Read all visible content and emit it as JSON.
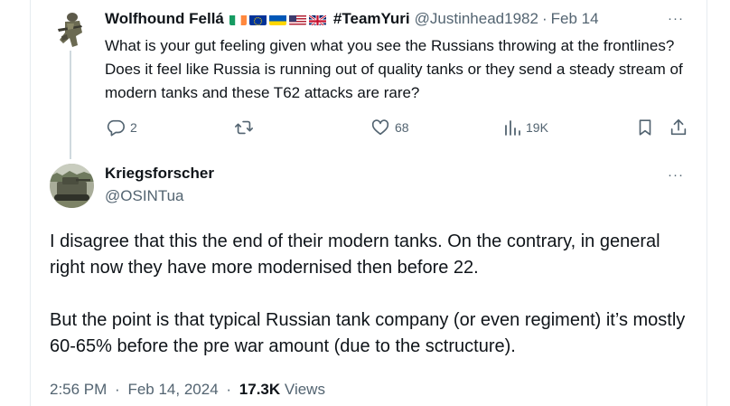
{
  "reply_tweet": {
    "author": {
      "display_name": "Wolfhound Fellá",
      "flags": [
        "ireland-flag",
        "eu-flag",
        "ukraine-flag",
        "usa-flag",
        "uk-flag"
      ],
      "hashtag": "#TeamYuri",
      "handle": "@Justinhead1982",
      "date": "Feb 14"
    },
    "text": "What is your gut feeling given what you see the Russians throwing at the frontlines? Does it feel like Russia is running out of quality tanks or they send a steady stream of modern tanks and these T62 attacks are rare?",
    "stats": {
      "replies": "2",
      "reposts": "",
      "likes": "68",
      "views": "19K"
    }
  },
  "main_tweet": {
    "author": {
      "display_name": "Kriegsforscher",
      "handle": "@OSINTua"
    },
    "paragraphs": [
      "I disagree that this the end of their modern tanks. On the contrary, in general right now they have more modernised then before 22.",
      "But the point is that typical Russian tank company (or even regiment) it’s mostly 60-65% before the pre war amount (due to the sctructure)."
    ],
    "time": "2:56 PM",
    "date": "Feb 14, 2024",
    "views_count": "17.3K",
    "views_label": "Views"
  },
  "ui": {
    "separator": "·",
    "more": "···"
  },
  "colors": {
    "text": "#0f1419",
    "secondary": "#536471",
    "divider": "#e6ecf0",
    "thread_line": "#cfd9de"
  }
}
